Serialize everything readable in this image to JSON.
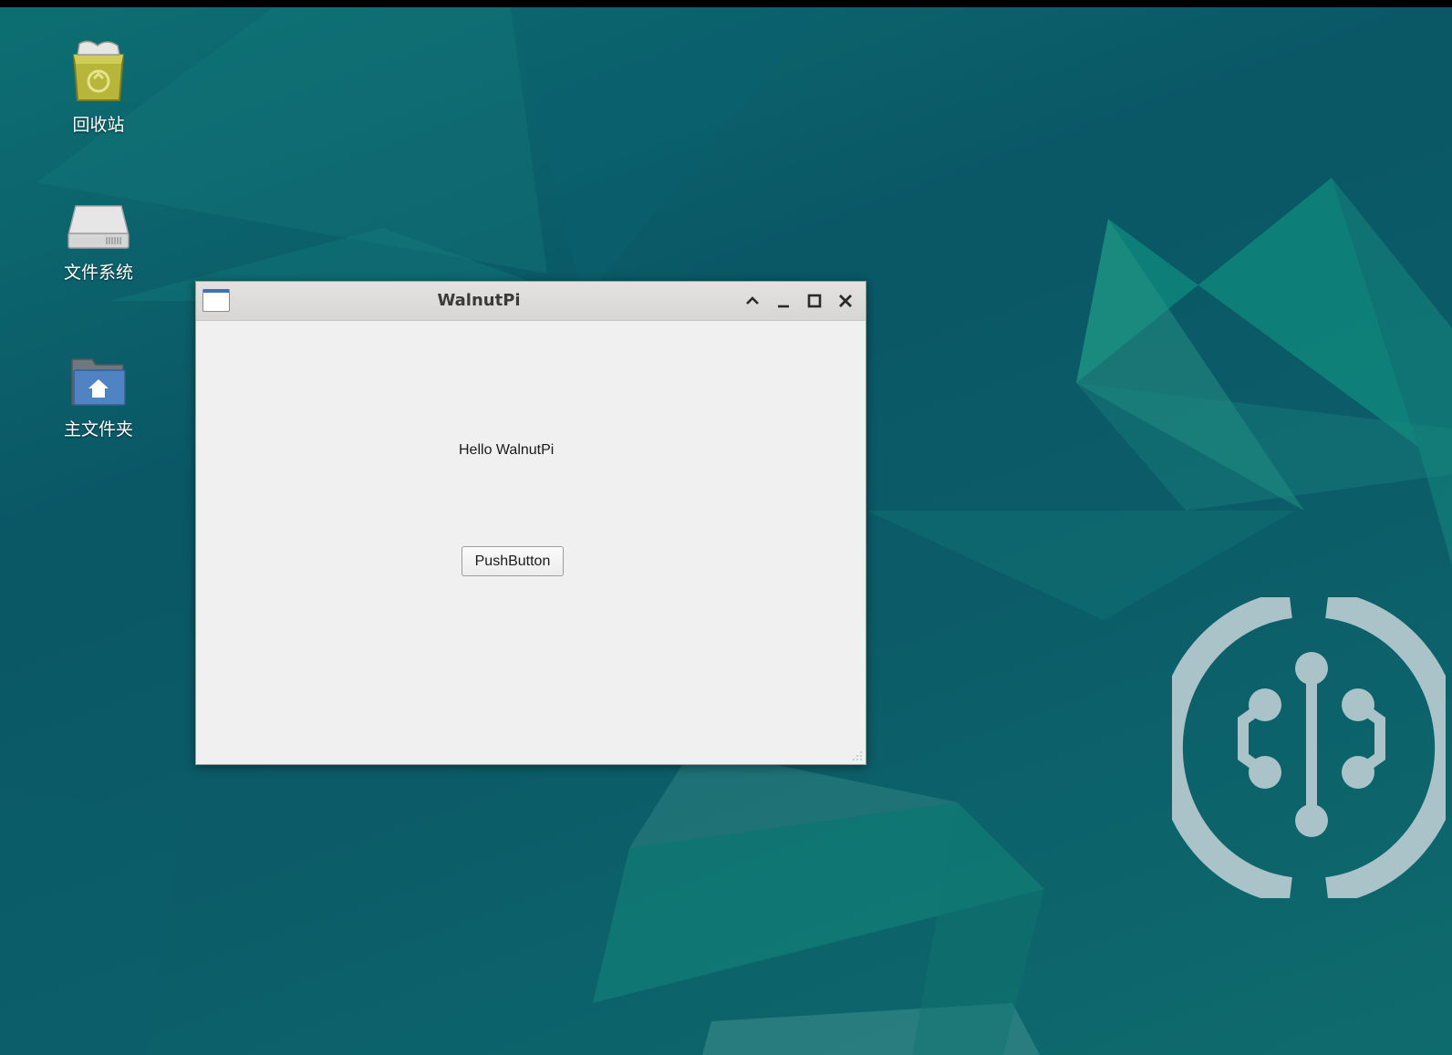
{
  "desktop": {
    "icons": [
      {
        "label": "回收站",
        "icon": "trash-icon"
      },
      {
        "label": "文件系统",
        "icon": "drive-icon"
      },
      {
        "label": "主文件夹",
        "icon": "home-folder-icon"
      }
    ],
    "logo": "walnutpi-logo"
  },
  "window": {
    "title": "WalnutPi",
    "buttons": [
      "shade-icon",
      "minimize-icon",
      "maximize-icon",
      "close-icon"
    ],
    "label_text": "Hello WalnutPi",
    "button_label": "PushButton"
  },
  "colors": {
    "wallpaper_dark": "#0a5766",
    "wallpaper_accent": "#12a088",
    "logo": "#a9c3c8"
  }
}
